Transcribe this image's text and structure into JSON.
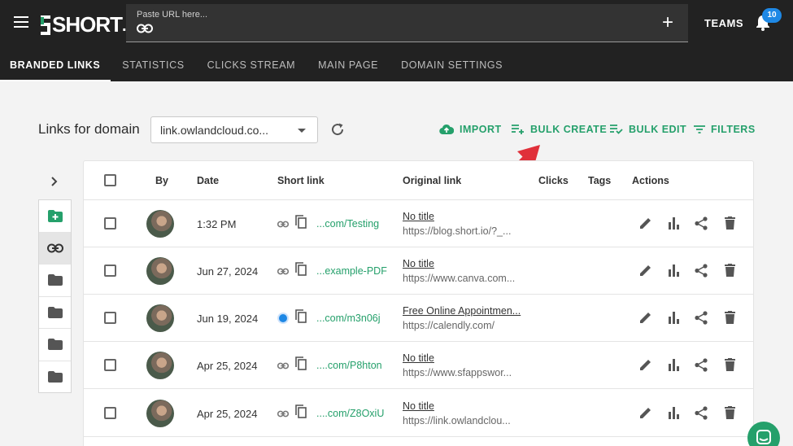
{
  "header": {
    "logo_text": "SHORT",
    "logo_suffix": ".io",
    "url_placeholder": "Paste URL here...",
    "teams_label": "TEAMS",
    "notification_count": "10",
    "accent_color": "#25a06b"
  },
  "tabs": [
    {
      "label": "BRANDED LINKS",
      "active": true
    },
    {
      "label": "STATISTICS"
    },
    {
      "label": "CLICKS STREAM"
    },
    {
      "label": "MAIN PAGE"
    },
    {
      "label": "DOMAIN SETTINGS"
    }
  ],
  "toolbar": {
    "heading": "Links for domain",
    "domain_value": "link.owlandcloud.co...",
    "import_label": "IMPORT",
    "bulk_create_label": "BULK CREATE",
    "bulk_edit_label": "BULK EDIT",
    "filters_label": "FILTERS"
  },
  "table": {
    "columns": [
      "By",
      "Date",
      "Short link",
      "Original link",
      "Clicks",
      "Tags",
      "Actions"
    ],
    "rows": [
      {
        "date": "1:32 PM",
        "short": "...com/Testing",
        "title": "No title",
        "url": "https://blog.short.io/?_..."
      },
      {
        "date": "Jun 27, 2024",
        "short": "...example-PDF",
        "title": "No title",
        "url": "https://www.canva.com..."
      },
      {
        "date": "Jun 19, 2024",
        "short": "...com/m3n06j",
        "title": "Free Online Appointmen...",
        "url": "https://calendly.com/"
      },
      {
        "date": "Apr 25, 2024",
        "short": "....com/P8hton",
        "title": "No title",
        "url": "https://www.sfappswor..."
      },
      {
        "date": "Apr 25, 2024",
        "short": "....com/Z8OxiU",
        "title": "No title",
        "url": "https://link.owlandclou..."
      }
    ]
  }
}
